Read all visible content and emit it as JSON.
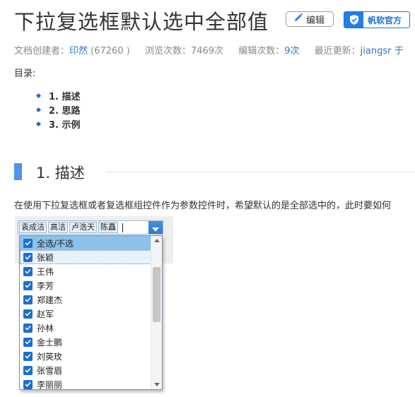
{
  "page": {
    "title": "下拉复选框默认选中全部值",
    "edit_button": "编辑",
    "official_button": "帆软官方"
  },
  "meta": {
    "creator_label": "文档创建者：",
    "creator_name": "印然",
    "creator_id": "(67260 )",
    "views_label": "浏览次数：",
    "views_value": "7469次",
    "edits_label": "编辑次数：",
    "edits_value": "9次",
    "updated_label": "最近更新：",
    "updated_value": "jiangsr 于"
  },
  "toc": {
    "label": "目录:",
    "items": [
      "1. 描述",
      "2. 思路",
      "3. 示例"
    ]
  },
  "section": {
    "title": "1. 描述",
    "text": "在使用下拉复选框或者复选框组控件作为参数控件时，希望默认的是全部选中的，此时要如何"
  },
  "combo": {
    "chips": [
      "袁成洁",
      "高洁",
      "卢浩天",
      "陈矗"
    ]
  },
  "dropdown": {
    "items": [
      {
        "label": "全选/不选",
        "checked": true
      },
      {
        "label": "张颖",
        "checked": true
      },
      {
        "label": "王伟",
        "checked": true
      },
      {
        "label": "李芳",
        "checked": true
      },
      {
        "label": "郑建杰",
        "checked": true
      },
      {
        "label": "赵军",
        "checked": true
      },
      {
        "label": "孙林",
        "checked": true
      },
      {
        "label": "金士鹏",
        "checked": true
      },
      {
        "label": "刘英玫",
        "checked": true
      },
      {
        "label": "张雪眉",
        "checked": true
      },
      {
        "label": "李丽丽",
        "checked": true
      }
    ]
  },
  "colors": {
    "accent": "#1f7ee8",
    "link": "#3273c4",
    "section_bar": "#4c95e8",
    "selected_row": "#8bc1ea"
  },
  "icons": [
    "pencil-icon",
    "shield-check-icon",
    "chevron-down-icon",
    "checkbox-checked-icon"
  ]
}
